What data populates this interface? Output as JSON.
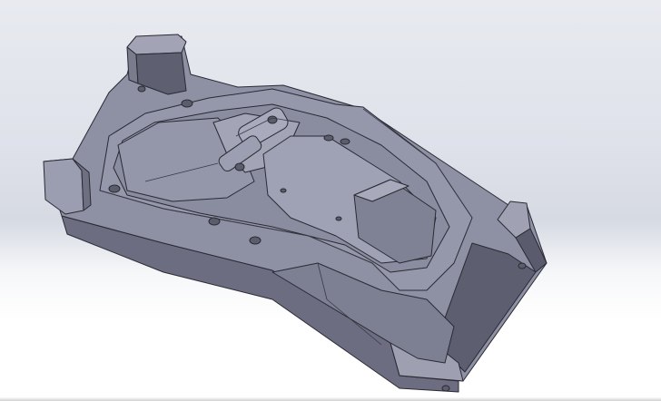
{
  "viewport": {
    "view": "3d-model-view",
    "colors": {
      "part_face": "#8e90a4",
      "part_light": "#a4a6b8",
      "part_dark": "#5f6072",
      "edge": "#2a2a33",
      "background_top": "#e8eaf0",
      "background_bottom": "#ffffff"
    }
  }
}
